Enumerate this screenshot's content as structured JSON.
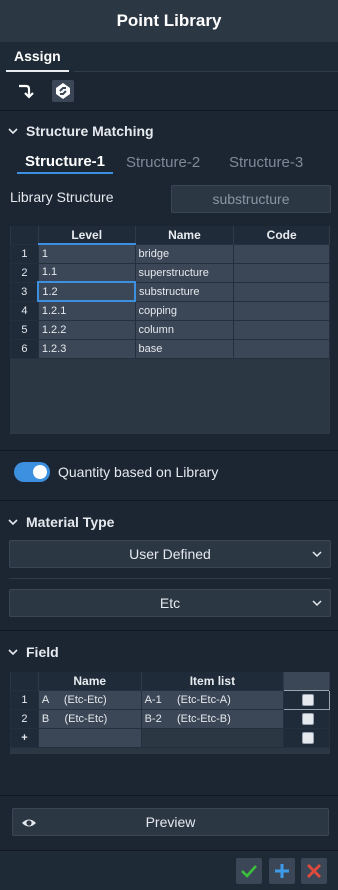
{
  "window": {
    "title": "Point Library"
  },
  "tabs": {
    "assign": "Assign"
  },
  "structure_matching": {
    "title": "Structure Matching",
    "subtabs": [
      "Structure-1",
      "Structure-2",
      "Structure-3"
    ],
    "library_structure_label": "Library Structure",
    "library_structure_value": "substructure",
    "columns": [
      "Level",
      "Name",
      "Code"
    ],
    "rows": [
      {
        "num": "1",
        "level": "1",
        "name": "bridge",
        "code": ""
      },
      {
        "num": "2",
        "level": "1.1",
        "name": "superstructure",
        "code": ""
      },
      {
        "num": "3",
        "level": "1.2",
        "name": "substructure",
        "code": ""
      },
      {
        "num": "4",
        "level": "1.2.1",
        "name": "copping",
        "code": ""
      },
      {
        "num": "5",
        "level": "1.2.2",
        "name": "column",
        "code": ""
      },
      {
        "num": "6",
        "level": "1.2.3",
        "name": "base",
        "code": ""
      }
    ]
  },
  "quantity_toggle": {
    "label": "Quantity based on Library",
    "on": true
  },
  "material_type": {
    "title": "Material Type",
    "dropdown1": "User Defined",
    "dropdown2": "Etc"
  },
  "field": {
    "title": "Field",
    "columns": [
      "Name",
      "Item list"
    ],
    "rows": [
      {
        "num": "1",
        "name": "A     (Etc-Etc)",
        "item": "A-1     (Etc-Etc-A)"
      },
      {
        "num": "2",
        "name": "B     (Etc-Etc)",
        "item": "B-2     (Etc-Etc-B)"
      }
    ],
    "new_row_marker": "+"
  },
  "preview": {
    "label": "Preview"
  },
  "colors": {
    "accent": "#3d8fe0",
    "ok": "#3cc03c",
    "add": "#3d9be9",
    "cancel": "#e04a3c"
  }
}
